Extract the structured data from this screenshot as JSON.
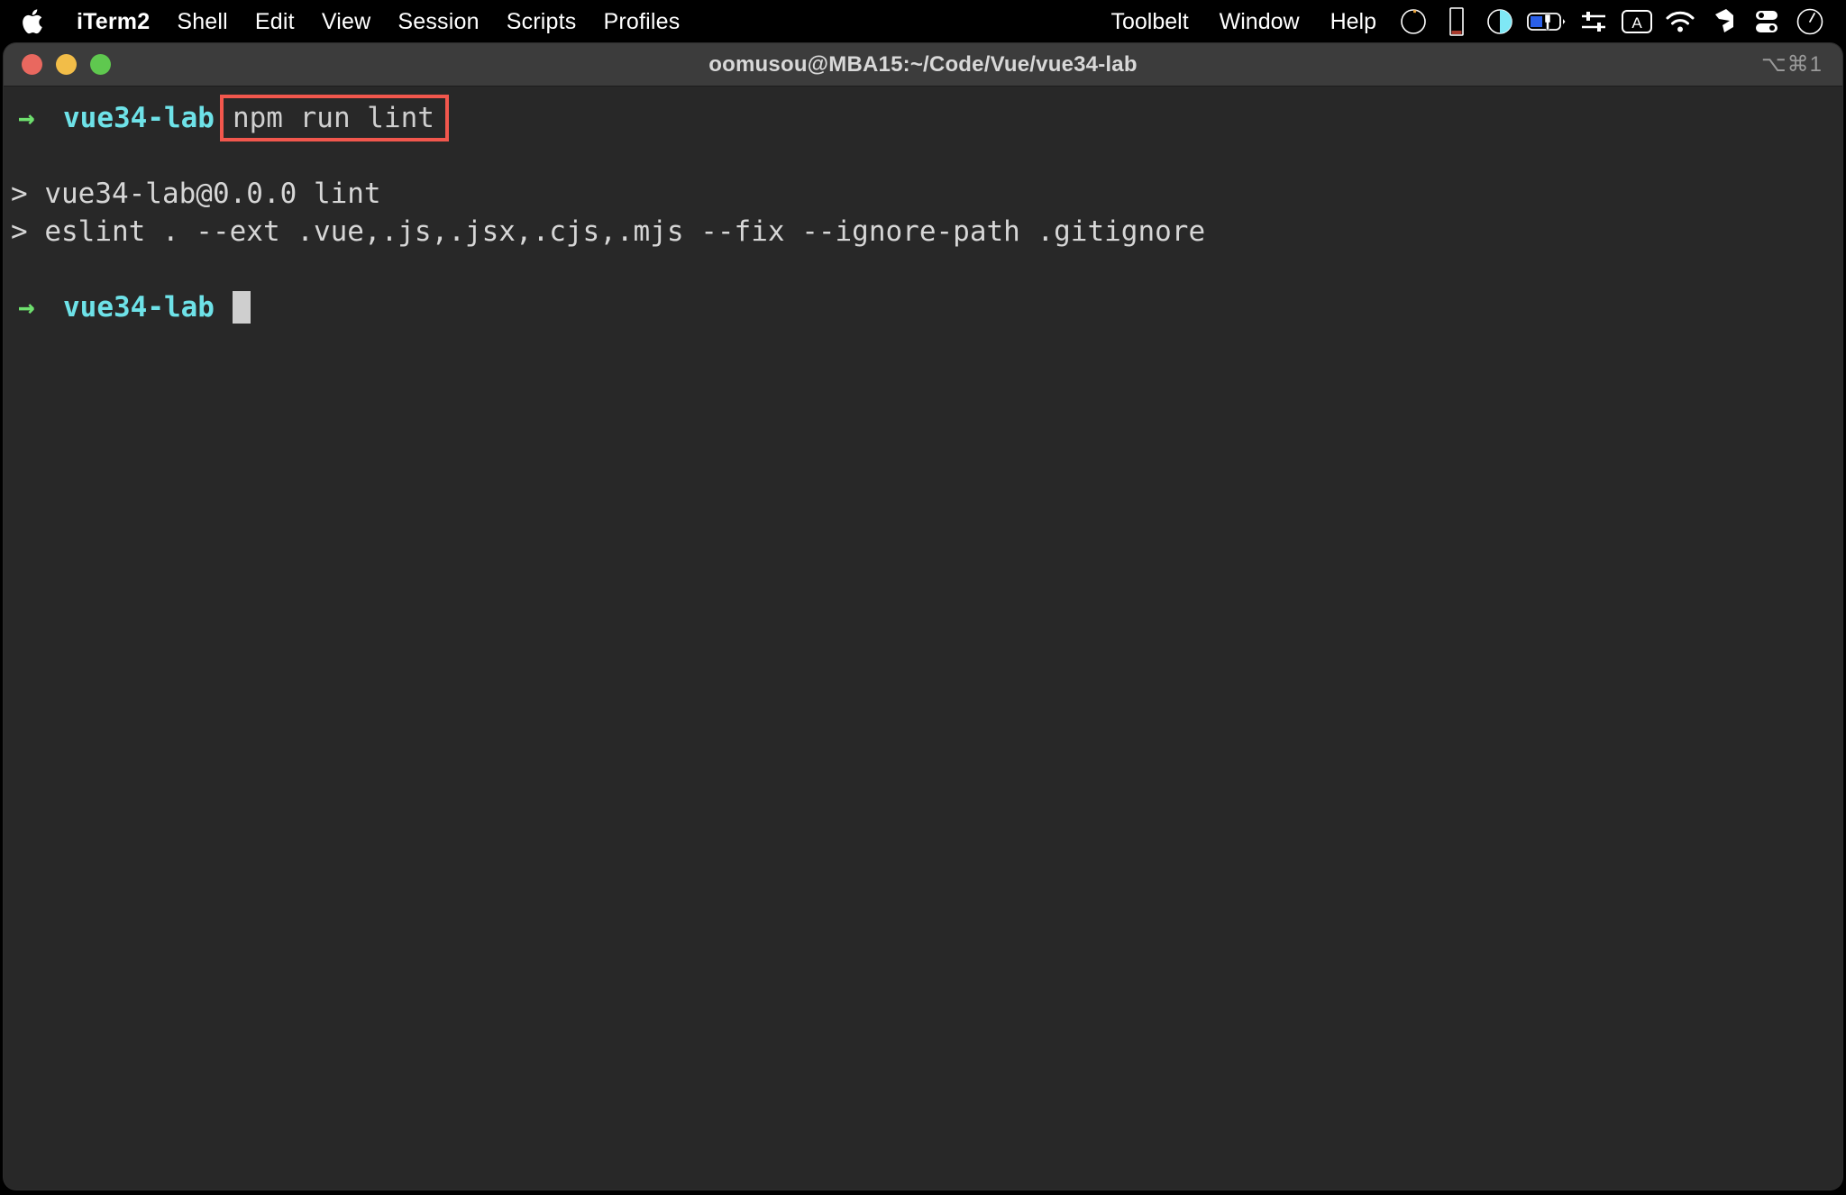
{
  "menubar": {
    "apple_icon": "apple-logo-icon",
    "items": [
      {
        "label": "iTerm2",
        "bold": true
      },
      {
        "label": "Shell",
        "bold": false
      },
      {
        "label": "Edit",
        "bold": false
      },
      {
        "label": "View",
        "bold": false
      },
      {
        "label": "Session",
        "bold": false
      },
      {
        "label": "Scripts",
        "bold": false
      },
      {
        "label": "Profiles",
        "bold": false
      }
    ],
    "right_items": [
      {
        "label": "Toolbelt"
      },
      {
        "label": "Window"
      },
      {
        "label": "Help"
      }
    ],
    "status_icons": [
      {
        "name": "stats-ring-icon"
      },
      {
        "name": "memory-bar-icon"
      },
      {
        "name": "display-brightness-icon"
      },
      {
        "name": "battery-charging-icon"
      },
      {
        "name": "sliders-control-icon"
      },
      {
        "name": "input-source-a-icon"
      },
      {
        "name": "wifi-icon"
      },
      {
        "name": "dropbox-icon"
      },
      {
        "name": "control-center-icon"
      },
      {
        "name": "siri-clock-icon"
      }
    ]
  },
  "window": {
    "title": "oomusou@MBA15:~/Code/Vue/vue34-lab",
    "badge": "⌥⌘1",
    "traffic_lights": [
      {
        "name": "close-button",
        "color": "#e9685f"
      },
      {
        "name": "minimize-button",
        "color": "#f2bd48"
      },
      {
        "name": "maximize-button",
        "color": "#5fc84f"
      }
    ]
  },
  "terminal": {
    "prompt_arrow": "→",
    "cwd": "vue34-lab",
    "command": "npm run lint",
    "highlight_color": "#f2574d",
    "output_lines": [
      "> vue34-lab@0.0.0 lint",
      "> eslint . --ext .vue,.js,.jsx,.cjs,.mjs --fix --ignore-path .gitignore"
    ],
    "final_prompt_arrow": "→",
    "final_cwd": "vue34-lab",
    "cursor": "block"
  }
}
